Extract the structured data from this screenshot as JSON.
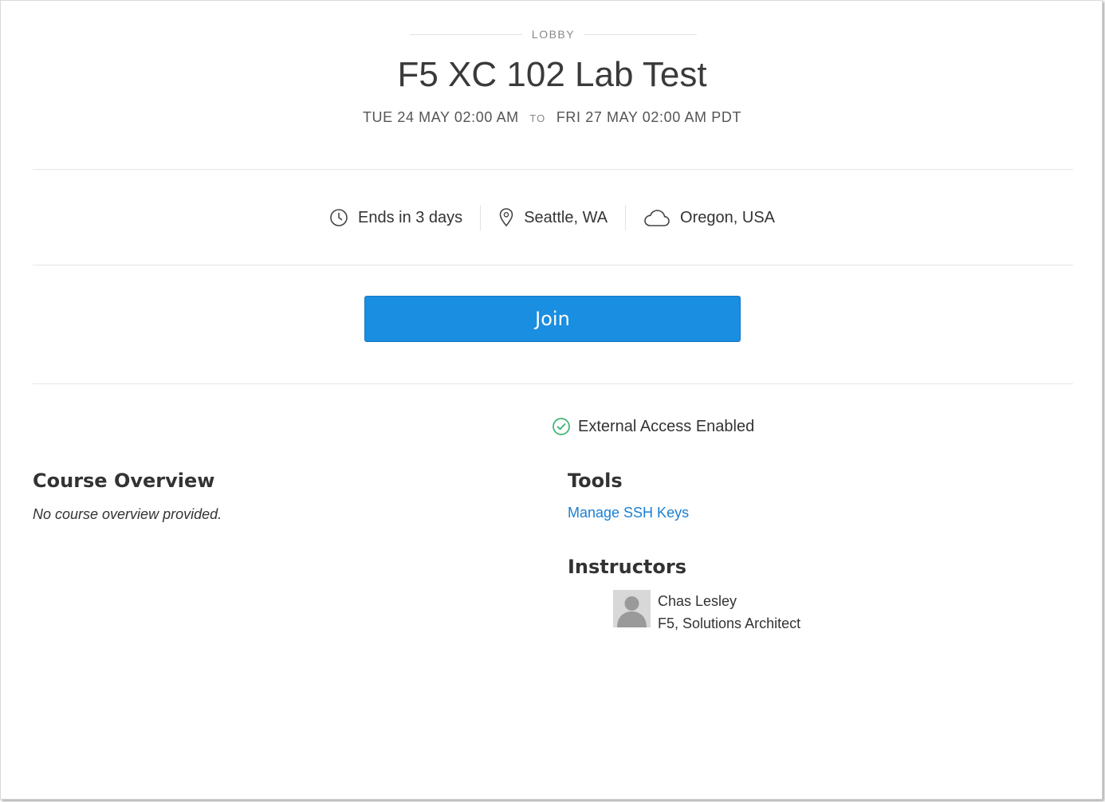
{
  "header": {
    "eyebrow": "LOBBY",
    "title": "F5 XC 102 Lab Test",
    "start": "TUE 24 MAY 02:00 AM",
    "to": "TO",
    "end": "FRI 27 MAY 02:00 AM PDT"
  },
  "meta": {
    "ends": "Ends in 3 days",
    "location": "Seattle, WA",
    "region": "Oregon, USA",
    "icons": [
      "clock-icon",
      "map-pin-icon",
      "cloud-icon"
    ]
  },
  "join_label": "Join",
  "access_status": "External Access Enabled",
  "course": {
    "heading": "Course Overview",
    "text": "No course overview provided."
  },
  "tools": {
    "heading": "Tools",
    "link": "Manage SSH Keys"
  },
  "instructors": {
    "heading": "Instructors",
    "list": [
      {
        "name": "Chas Lesley",
        "role": "F5, Solutions Architect"
      }
    ]
  },
  "colors": {
    "primary": "#1a8ee0",
    "link": "#1a7fd4",
    "success": "#3cb371"
  }
}
